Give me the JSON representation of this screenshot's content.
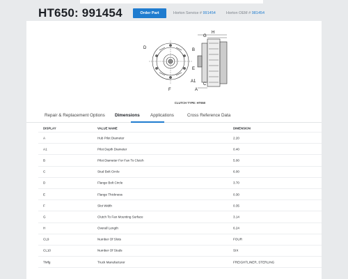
{
  "header": {
    "title": "HT650: 991454",
    "order_button": "Order Part",
    "horton_service_label": "Horton Service #",
    "horton_service_number": "991454",
    "horton_oem_label": "Horton OEM #",
    "horton_oem_number": "981454"
  },
  "diagram": {
    "caption": "CLUTCH TYPE: HT650",
    "labels": [
      "D",
      "B",
      "E",
      "F",
      "H",
      "G",
      "A1",
      "A",
      "C"
    ]
  },
  "tabs": [
    {
      "label": "Repair & Replacement Options",
      "active": false
    },
    {
      "label": "Dimensions",
      "active": true
    },
    {
      "label": "Applications",
      "active": false
    },
    {
      "label": "Cross Reference Data",
      "active": false
    }
  ],
  "table": {
    "columns": [
      "DISPLAY",
      "VALUE NAME",
      "DIMENSION"
    ],
    "rows": [
      [
        "A",
        "Hub Pilot Diameter",
        "2.20"
      ],
      [
        "A1",
        "Pilot Depth Diameter",
        "0.40"
      ],
      [
        "B",
        "Pilot Diameter For Fan To Clutch",
        "5.00"
      ],
      [
        "C",
        "Stud Bolt Circle",
        "6.00"
      ],
      [
        "D",
        "Flange Bolt Circle",
        "3.70"
      ],
      [
        "E",
        "Flange Thickness",
        "0.30"
      ],
      [
        "F",
        "Slot Width",
        "0.35"
      ],
      [
        "G",
        "Clutch To Fan Mounting Surface",
        "3.14"
      ],
      [
        "H",
        "Overall Length",
        "6.24"
      ],
      [
        "CL9",
        "Number Of Slots",
        "FOUR"
      ],
      [
        "CL10",
        "Number Of Studs",
        "SIX"
      ],
      [
        "TMfg",
        "Truck Manufacturer",
        "FREIGHTLINER, STERLING"
      ]
    ]
  },
  "colors": {
    "accent": "#1f7ccf",
    "background": "#e8eaec"
  }
}
